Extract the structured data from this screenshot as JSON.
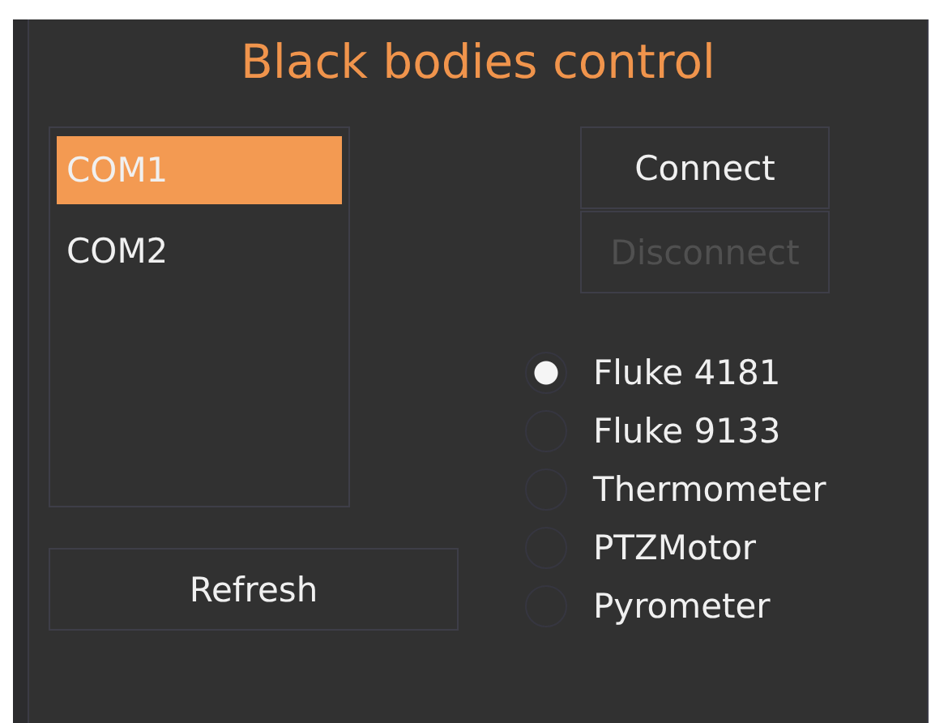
{
  "title": "Black bodies control",
  "ports": [
    {
      "label": "COM1",
      "selected": true
    },
    {
      "label": "COM2",
      "selected": false
    }
  ],
  "buttons": {
    "refresh": {
      "label": "Refresh",
      "disabled": false
    },
    "connect": {
      "label": "Connect",
      "disabled": false
    },
    "disconnect": {
      "label": "Disconnect",
      "disabled": true
    }
  },
  "devices": [
    {
      "label": "Fluke 4181",
      "selected": true
    },
    {
      "label": "Fluke 9133",
      "selected": false
    },
    {
      "label": "Thermometer",
      "selected": false
    },
    {
      "label": "PTZMotor",
      "selected": false
    },
    {
      "label": "Pyrometer",
      "selected": false
    }
  ]
}
